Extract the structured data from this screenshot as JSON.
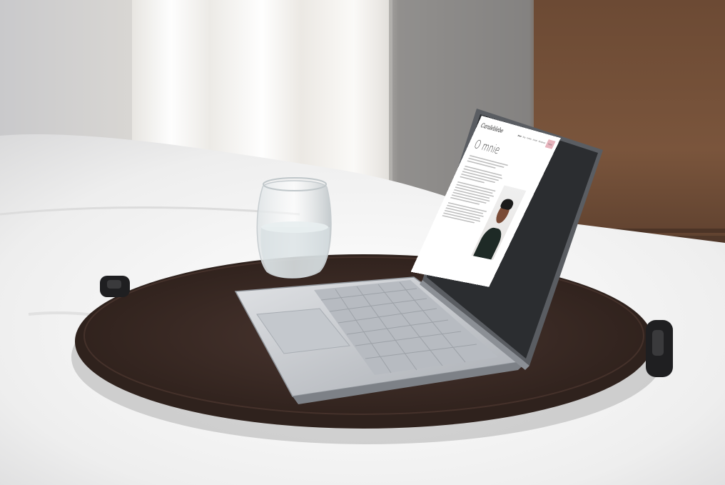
{
  "photo": {
    "subject": "laptop on a round wooden tray on a bed",
    "colors": {
      "bedding": "#f2f2f2",
      "tray": "#3b2a24",
      "wood_wall": "#6b4a35",
      "curtain": "#ece9e4",
      "laptop": "#c9ccd0"
    }
  },
  "website": {
    "logo": "Caraleblebe",
    "nav": [
      "Home",
      "Blog",
      "Portfolio",
      "Kontakt",
      "Współpraca"
    ],
    "cta_label": "Napisz",
    "title": "O mnie",
    "accent": "#e8b4bd"
  }
}
